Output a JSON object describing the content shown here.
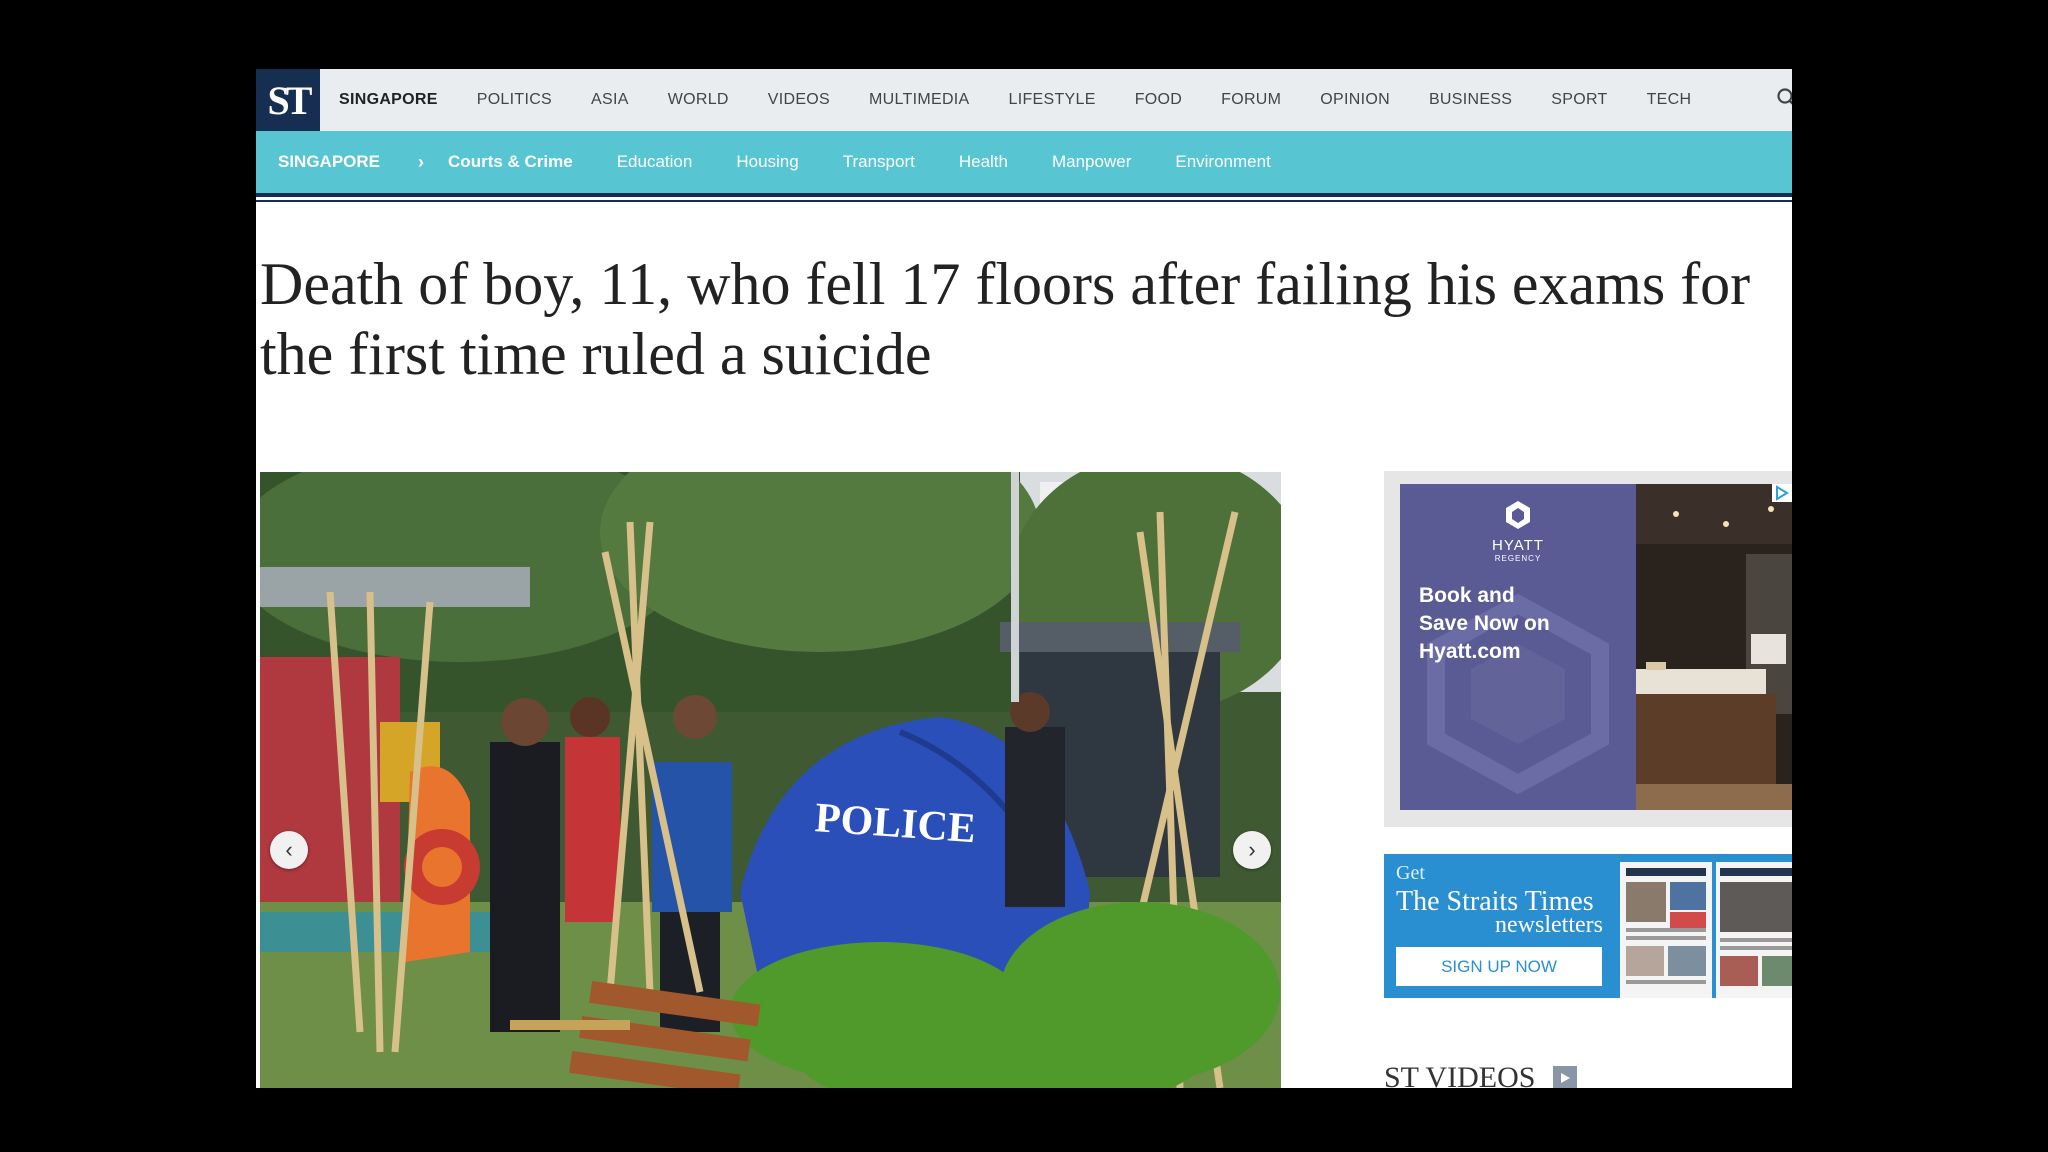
{
  "logo": {
    "text": "ST"
  },
  "top_nav": {
    "items": [
      "SINGAPORE",
      "POLITICS",
      "ASIA",
      "WORLD",
      "VIDEOS",
      "MULTIMEDIA",
      "LIFESTYLE",
      "FOOD",
      "FORUM",
      "OPINION",
      "BUSINESS",
      "SPORT",
      "TECH"
    ],
    "active": "SINGAPORE"
  },
  "sub_nav": {
    "section": "SINGAPORE",
    "items": [
      "Courts & Crime",
      "Education",
      "Housing",
      "Transport",
      "Health",
      "Manpower",
      "Environment"
    ],
    "active": "Courts & Crime"
  },
  "article": {
    "headline_line1": "Death of boy, 11, who fell 17 floors after failing his exams for",
    "headline_line2": "the first time ruled a suicide",
    "photo": {
      "tent_text": "POLICE",
      "prev_icon": "chevron-left-icon",
      "next_icon": "chevron-right-icon"
    }
  },
  "ad": {
    "brand": "HYATT",
    "brand_sub": "REGENCY",
    "line1": "Book and",
    "line2": "Save Now on",
    "line3": "Hyatt.com"
  },
  "newsletter": {
    "get": "Get",
    "brand": "The Straits Times",
    "type": "newsletters",
    "button": "SIGN UP NOW"
  },
  "videos": {
    "title": "ST VIDEOS"
  },
  "colors": {
    "nav_bg": "#e9edf0",
    "subnav_bg": "#57c5d2",
    "logo_bg": "#162e52",
    "newsletter_bg": "#2a8fd0",
    "ad_bg": "#5a5b94"
  }
}
